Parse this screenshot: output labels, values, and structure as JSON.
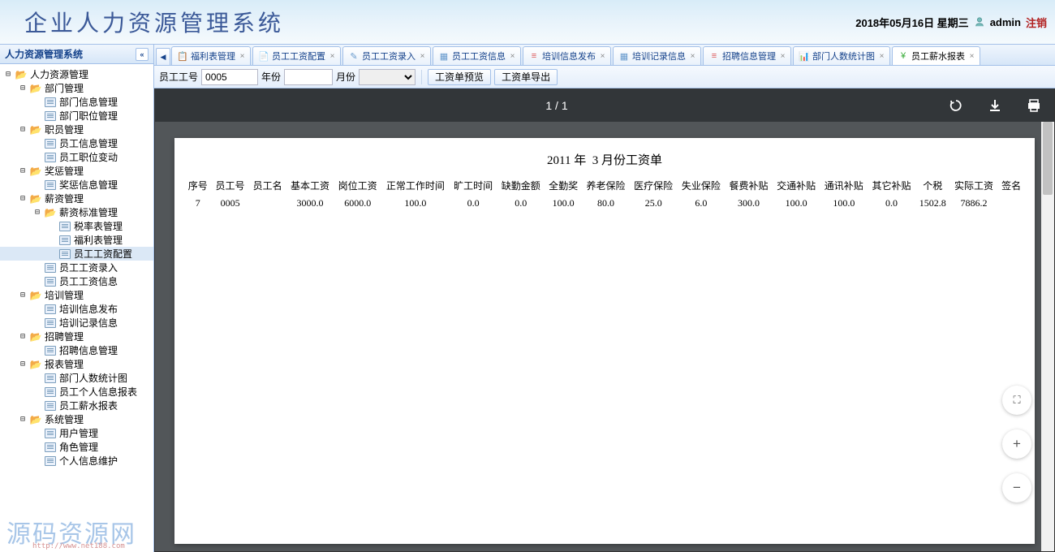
{
  "header": {
    "title": "企业人力资源管理系统",
    "date": "2018年05月16日 星期三",
    "user": "admin",
    "logout": "注销"
  },
  "sidebar": {
    "title": "人力资源管理系统",
    "tree": [
      {
        "level": 0,
        "type": "folder",
        "open": true,
        "label": "人力资源管理"
      },
      {
        "level": 1,
        "type": "folder",
        "open": true,
        "label": "部门管理"
      },
      {
        "level": 2,
        "type": "leaf",
        "label": "部门信息管理"
      },
      {
        "level": 2,
        "type": "leaf",
        "label": "部门职位管理"
      },
      {
        "level": 1,
        "type": "folder",
        "open": true,
        "label": "职员管理"
      },
      {
        "level": 2,
        "type": "leaf",
        "label": "员工信息管理"
      },
      {
        "level": 2,
        "type": "leaf",
        "label": "员工职位变动"
      },
      {
        "level": 1,
        "type": "folder",
        "open": true,
        "label": "奖惩管理"
      },
      {
        "level": 2,
        "type": "leaf",
        "label": "奖惩信息管理"
      },
      {
        "level": 1,
        "type": "folder",
        "open": true,
        "label": "薪资管理"
      },
      {
        "level": 2,
        "type": "folder",
        "open": true,
        "label": "薪资标准管理"
      },
      {
        "level": 3,
        "type": "leaf",
        "label": "税率表管理"
      },
      {
        "level": 3,
        "type": "leaf",
        "label": "福利表管理"
      },
      {
        "level": 3,
        "type": "leaf",
        "label": "员工工资配置",
        "selected": true
      },
      {
        "level": 2,
        "type": "leaf",
        "label": "员工工资录入"
      },
      {
        "level": 2,
        "type": "leaf",
        "label": "员工工资信息"
      },
      {
        "level": 1,
        "type": "folder",
        "open": true,
        "label": "培训管理"
      },
      {
        "level": 2,
        "type": "leaf",
        "label": "培训信息发布"
      },
      {
        "level": 2,
        "type": "leaf",
        "label": "培训记录信息"
      },
      {
        "level": 1,
        "type": "folder",
        "open": true,
        "label": "招聘管理"
      },
      {
        "level": 2,
        "type": "leaf",
        "label": "招聘信息管理"
      },
      {
        "level": 1,
        "type": "folder",
        "open": true,
        "label": "报表管理"
      },
      {
        "level": 2,
        "type": "leaf",
        "label": "部门人数统计图"
      },
      {
        "level": 2,
        "type": "leaf",
        "label": "员工个人信息报表"
      },
      {
        "level": 2,
        "type": "leaf",
        "label": "员工薪水报表"
      },
      {
        "level": 1,
        "type": "folder",
        "open": true,
        "label": "系统管理"
      },
      {
        "level": 2,
        "type": "leaf",
        "label": "用户管理"
      },
      {
        "level": 2,
        "type": "leaf",
        "label": "角色管理"
      },
      {
        "level": 2,
        "type": "leaf",
        "label": "个人信息维护"
      }
    ]
  },
  "tabs": [
    {
      "label": "福利表管理",
      "icon": "📋",
      "color": "#5a8"
    },
    {
      "label": "员工工资配置",
      "icon": "📄",
      "color": "#e90"
    },
    {
      "label": "员工工资录入",
      "icon": "✎",
      "color": "#69c"
    },
    {
      "label": "员工工资信息",
      "icon": "▦",
      "color": "#69c"
    },
    {
      "label": "培训信息发布",
      "icon": "≡",
      "color": "#d55"
    },
    {
      "label": "培训记录信息",
      "icon": "▦",
      "color": "#69c"
    },
    {
      "label": "招聘信息管理",
      "icon": "≡",
      "color": "#d55"
    },
    {
      "label": "部门人数统计图",
      "icon": "📊",
      "color": "#69c"
    },
    {
      "label": "员工薪水报表",
      "icon": "¥",
      "color": "#3a3",
      "active": true
    }
  ],
  "filter": {
    "emp_id_label": "员工工号",
    "emp_id_value": "0005",
    "year_label": "年份",
    "month_label": "月份",
    "preview_btn": "工资单预览",
    "export_btn": "工资单导出"
  },
  "viewer": {
    "page_indicator": "1 / 1"
  },
  "doc": {
    "title_year": "2011",
    "title_year_suffix": "年",
    "title_month": "3",
    "title_suffix": "月份工资单",
    "columns": [
      "序号",
      "员工号",
      "员工名",
      "基本工资",
      "岗位工资",
      "正常工作时间",
      "旷工时间",
      "缺勤金额",
      "全勤奖",
      "养老保险",
      "医疗保险",
      "失业保险",
      "餐费补贴",
      "交通补贴",
      "通讯补贴",
      "其它补贴",
      "个税",
      "实际工资",
      "签名"
    ],
    "row": [
      "7",
      "0005",
      "",
      "3000.0",
      "6000.0",
      "100.0",
      "0.0",
      "0.0",
      "100.0",
      "80.0",
      "25.0",
      "6.0",
      "300.0",
      "100.0",
      "100.0",
      "0.0",
      "1502.8",
      "7886.2",
      ""
    ]
  },
  "watermark": {
    "main": "源码资源网",
    "sub": "http://www.net188.com"
  }
}
